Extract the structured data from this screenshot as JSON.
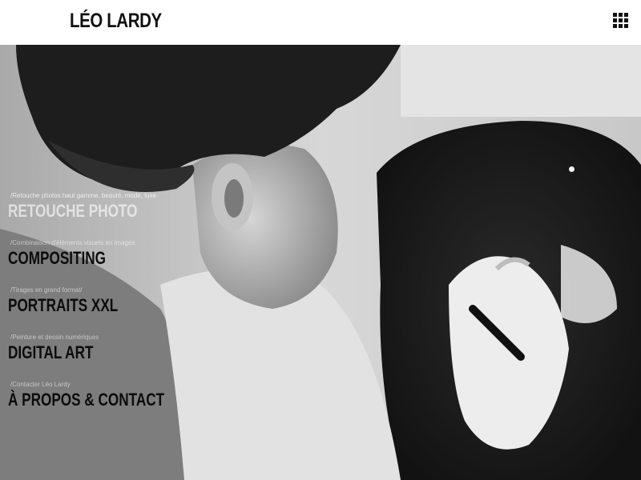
{
  "header": {
    "logo": "LÉO LARDY",
    "menu_icon": "grid-menu-icon"
  },
  "nav": {
    "items": [
      {
        "subtitle": "/Retouche photos haut gamme, beauté, mode, luxe",
        "title": "RETOUCHE PHOTO"
      },
      {
        "subtitle": "/Combinaison d'éléments visuels en images",
        "title": "COMPOSITING"
      },
      {
        "subtitle": "/Tirages en grand format/",
        "title": "PORTRAITS XXL"
      },
      {
        "subtitle": "/Peinture et dessin numériques",
        "title": "DIGITAL ART"
      },
      {
        "subtitle": "/Contacter Léo Lardy",
        "title": "À PROPOS & CONTACT"
      }
    ]
  }
}
